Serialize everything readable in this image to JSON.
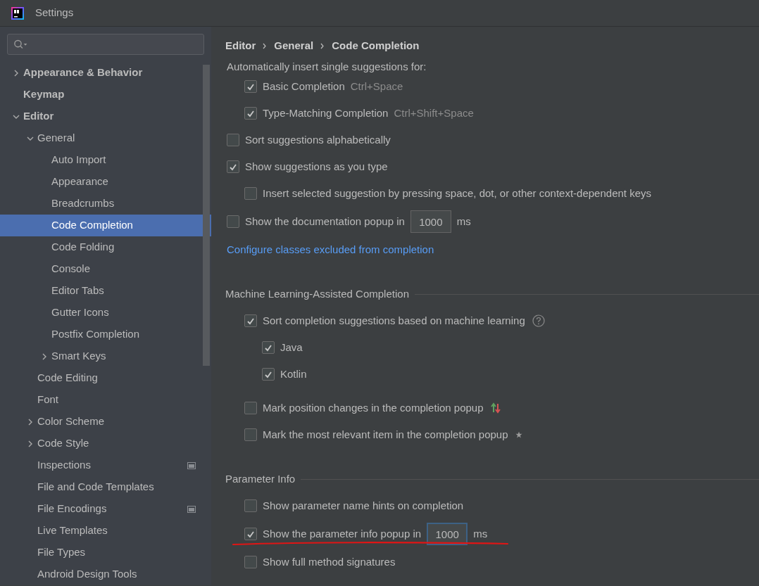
{
  "window": {
    "title": "Settings"
  },
  "sidebar": {
    "tree": [
      {
        "label": "Appearance & Behavior",
        "kind": "collapsed-folder",
        "selected": false
      },
      {
        "label": "Keymap",
        "kind": "page",
        "selected": false
      },
      {
        "label": "Editor",
        "kind": "expanded-folder",
        "selected": false,
        "children": [
          {
            "label": "General",
            "kind": "expanded-folder",
            "selected": false,
            "children": [
              {
                "label": "Auto Import",
                "kind": "page",
                "selected": false
              },
              {
                "label": "Appearance",
                "kind": "page",
                "selected": false
              },
              {
                "label": "Breadcrumbs",
                "kind": "page",
                "selected": false
              },
              {
                "label": "Code Completion",
                "kind": "page",
                "selected": true
              },
              {
                "label": "Code Folding",
                "kind": "page",
                "selected": false
              },
              {
                "label": "Console",
                "kind": "page",
                "selected": false
              },
              {
                "label": "Editor Tabs",
                "kind": "page",
                "selected": false
              },
              {
                "label": "Gutter Icons",
                "kind": "page",
                "selected": false
              },
              {
                "label": "Postfix Completion",
                "kind": "page",
                "selected": false
              },
              {
                "label": "Smart Keys",
                "kind": "collapsed-folder",
                "selected": false
              }
            ]
          },
          {
            "label": "Code Editing",
            "kind": "page",
            "selected": false
          },
          {
            "label": "Font",
            "kind": "page",
            "selected": false
          },
          {
            "label": "Color Scheme",
            "kind": "collapsed-folder",
            "selected": false
          },
          {
            "label": "Code Style",
            "kind": "collapsed-folder",
            "selected": false
          },
          {
            "label": "Inspections",
            "kind": "page",
            "selected": false,
            "project_scope": true
          },
          {
            "label": "File and Code Templates",
            "kind": "page",
            "selected": false
          },
          {
            "label": "File Encodings",
            "kind": "page",
            "selected": false,
            "project_scope": true
          },
          {
            "label": "Live Templates",
            "kind": "page",
            "selected": false
          },
          {
            "label": "File Types",
            "kind": "page",
            "selected": false
          },
          {
            "label": "Android Design Tools",
            "kind": "page",
            "selected": false
          }
        ]
      }
    ]
  },
  "breadcrumbs": [
    "Editor",
    "General",
    "Code Completion"
  ],
  "sections": [
    {
      "items": [
        {
          "kind": "text",
          "label": "Automatically insert single suggestions for:",
          "children": [
            {
              "kind": "checkbox",
              "label": "Basic Completion",
              "shortcut": "Ctrl+Space",
              "checked": true
            },
            {
              "kind": "checkbox",
              "label": "Type-Matching Completion",
              "shortcut": "Ctrl+Shift+Space",
              "checked": true
            }
          ]
        },
        {
          "kind": "checkbox",
          "label": "Sort suggestions alphabetically",
          "checked": false
        },
        {
          "kind": "checkbox",
          "label": "Show suggestions as you type",
          "checked": true,
          "children": [
            {
              "kind": "checkbox",
              "label": "Insert selected suggestion by pressing space, dot, or other context-dependent keys",
              "checked": false
            }
          ]
        },
        {
          "kind": "checkbox",
          "label": "Show the documentation popup in",
          "checked": false,
          "field": {
            "value": "1000",
            "focused": false
          },
          "unit": "ms"
        },
        {
          "kind": "link",
          "label": "Configure classes excluded from completion"
        }
      ]
    },
    {
      "title": "Machine Learning-Assisted Completion",
      "items": [
        {
          "kind": "help-checkbox",
          "label": "Sort completion suggestions based on machine learning",
          "checked": true,
          "children": [
            {
              "kind": "checkbox",
              "label": "Java",
              "checked": true
            },
            {
              "kind": "checkbox",
              "label": "Kotlin",
              "checked": true
            }
          ]
        },
        {
          "kind": "trend-checkbox",
          "label": "Mark position changes in the completion popup",
          "checked": false
        },
        {
          "kind": "star-checkbox",
          "label": "Mark the most relevant item in the completion popup",
          "checked": false
        }
      ]
    },
    {
      "title": "Parameter Info",
      "items": [
        {
          "kind": "checkbox",
          "label": "Show parameter name hints on completion",
          "checked": false
        },
        {
          "kind": "checkbox",
          "label": "Show the parameter info popup in",
          "checked": true,
          "field": {
            "value": "1000",
            "focused": true
          },
          "unit": "ms",
          "underlined": true
        },
        {
          "kind": "checkbox",
          "label": "Show full method signatures",
          "checked": false
        }
      ]
    }
  ]
}
